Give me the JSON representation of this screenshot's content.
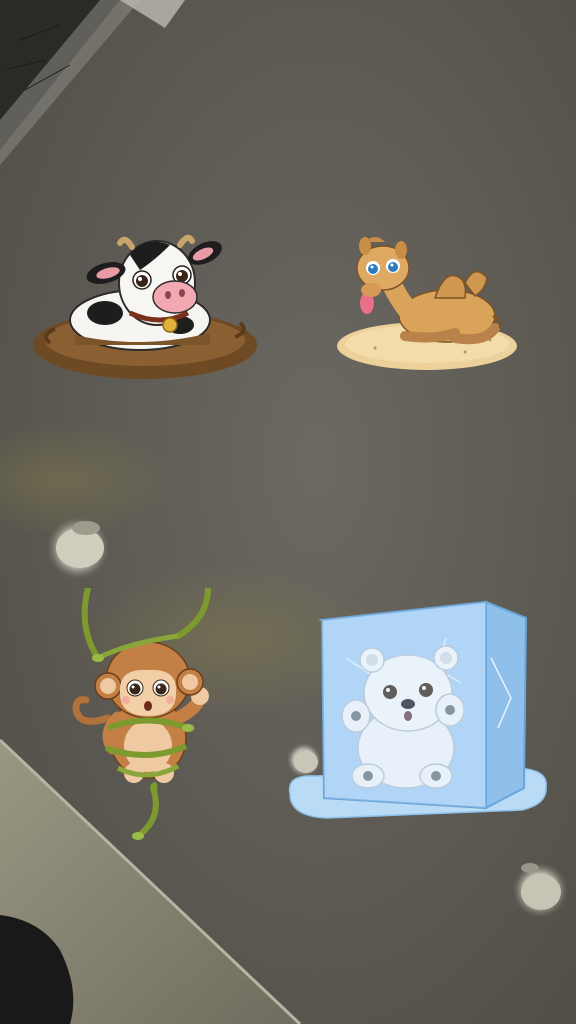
{
  "scene": {
    "kind": "ar-ceiling-camera-view",
    "colors": {
      "ceiling": "#615d57",
      "wall": "#8a8777",
      "ceiling_light": "#d8d6c8"
    }
  },
  "animals": [
    {
      "name": "cow",
      "predicament": "stuck-in-mud",
      "icon": "cow-icon"
    },
    {
      "name": "camel",
      "predicament": "thirsty-in-desert",
      "icon": "camel-icon"
    },
    {
      "name": "monkey",
      "predicament": "tangled-in-vines",
      "icon": "monkey-icon"
    },
    {
      "name": "polar bear",
      "predicament": "frozen-in-ice-cube",
      "icon": "polar-bear-icon"
    }
  ]
}
